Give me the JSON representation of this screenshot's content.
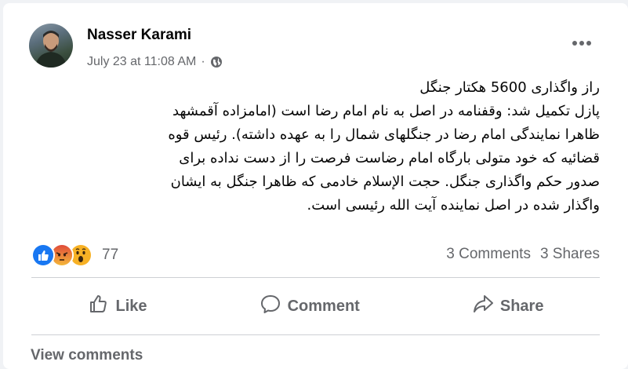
{
  "post": {
    "author": "Nasser Karami",
    "timestamp": "July 23 at 11:08 AM",
    "separator": "·",
    "privacy_icon": "globe-icon",
    "more_icon": "more-options-icon",
    "lines": [
      "راز واگذاری 5600 هکتار جنگل",
      "پازل تکمیل شد: وقفنامه در اصل به نام امام رضا است (امامزاده آقمشهد",
      "ظاهرا نمایندگی امام رضا در جنگلهای شمال را به عهده داشته). رئیس قوه",
      "قضائیه که خود متولی بارگاه امام رضاست فرصت را از دست نداده برای",
      "صدور حکم واگذاری جنگل. حجت الإسلام خادمی که ظاهرا جنگل به ایشان",
      "واگذار شده در اصل نماینده آیت الله رئیسی است."
    ]
  },
  "stats": {
    "reaction_icons": [
      "like-icon",
      "angry-icon",
      "wow-icon"
    ],
    "reaction_count": "77",
    "comments": "3 Comments",
    "shares": "3 Shares"
  },
  "actions": {
    "like": "Like",
    "comment": "Comment",
    "share": "Share"
  },
  "footer": {
    "view_comments": "View comments"
  },
  "colors": {
    "like_blue": "#1877f2",
    "angry_orange": "#e9710f",
    "wow_yellow": "#f7b125",
    "secondary_text": "#65676b"
  }
}
